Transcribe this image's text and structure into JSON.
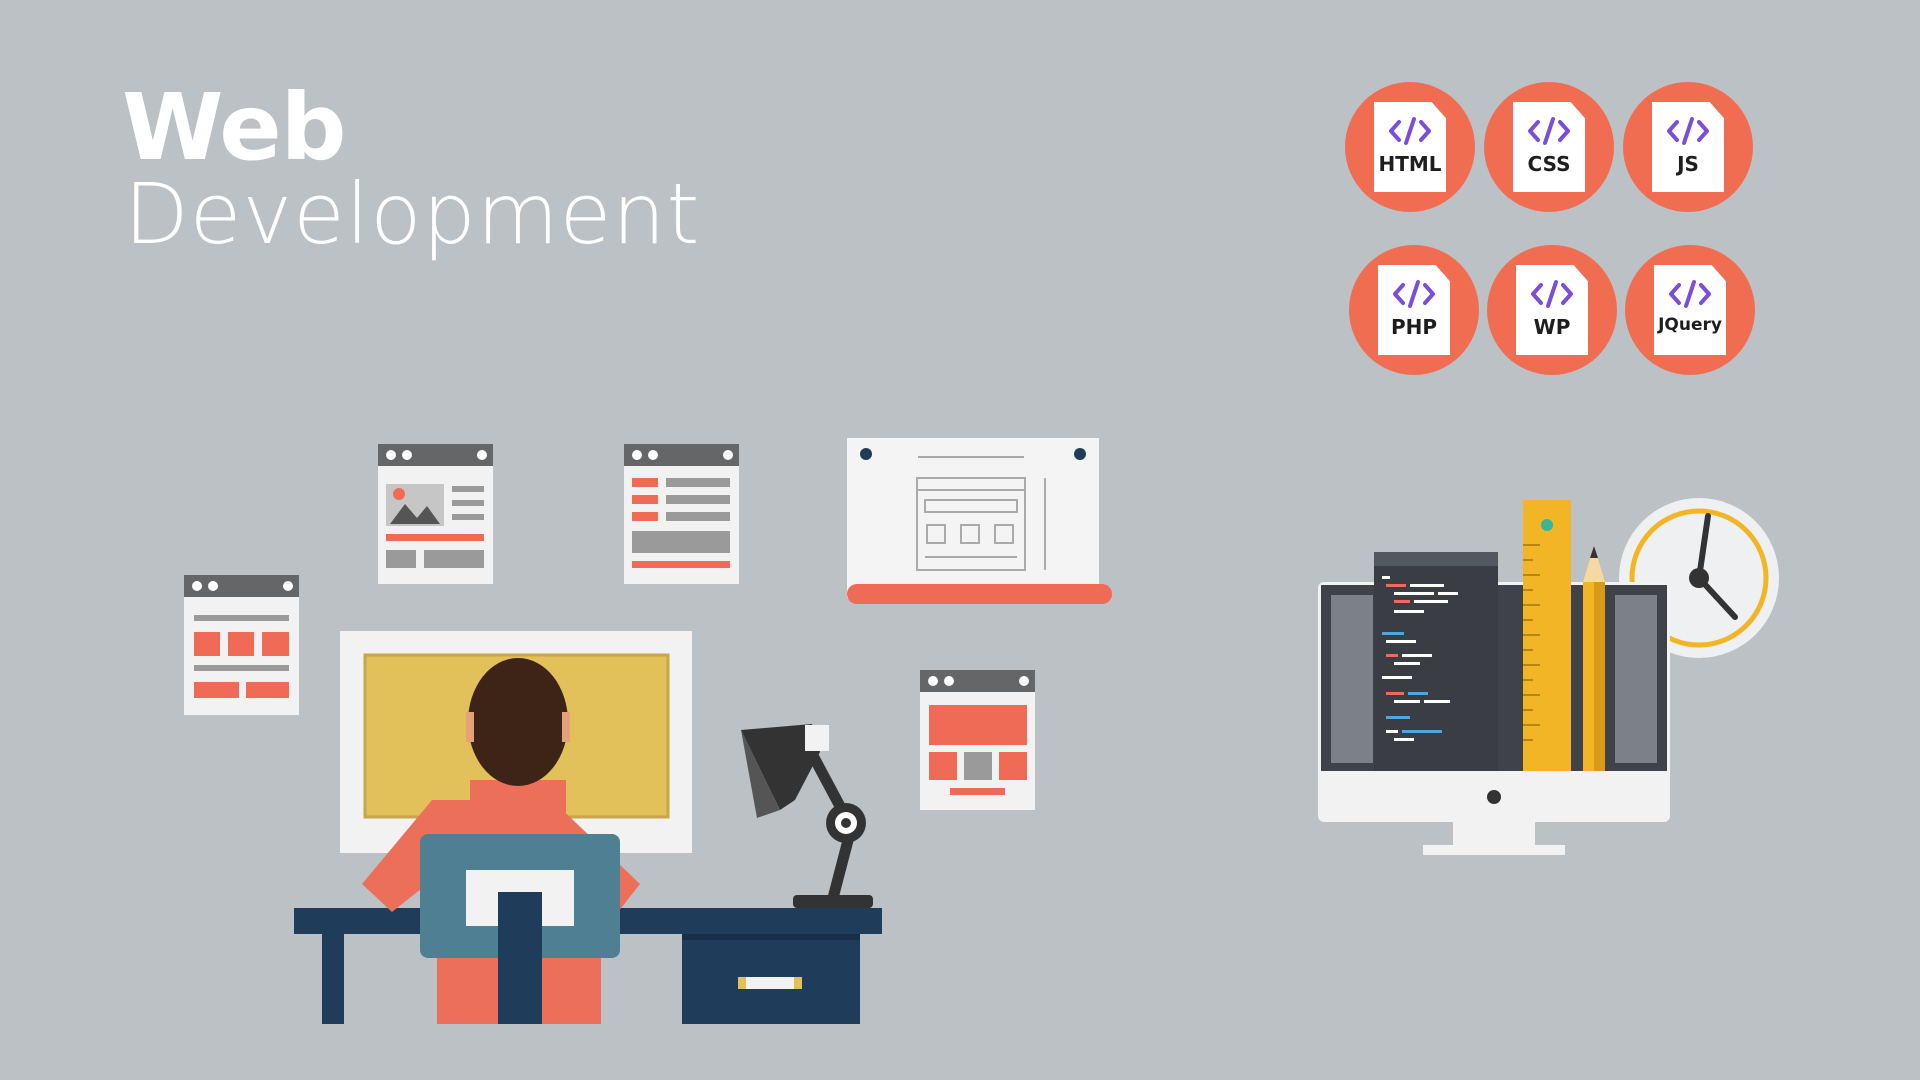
{
  "title": {
    "line1": "Web",
    "line2": "Development"
  },
  "badges": [
    {
      "label": "HTML",
      "icon": "code-icon"
    },
    {
      "label": "CSS",
      "icon": "code-icon"
    },
    {
      "label": "JS",
      "icon": "code-icon"
    },
    {
      "label": "PHP",
      "icon": "code-icon"
    },
    {
      "label": "WP",
      "icon": "code-icon"
    },
    {
      "label": "JQuery",
      "icon": "code-icon"
    }
  ],
  "colors": {
    "background": "#bcc1c5",
    "accent": "#f16d52",
    "screen_yellow": "#e2c05a",
    "desk": "#1f3c5a",
    "code_purple": "#7a4ed9"
  }
}
